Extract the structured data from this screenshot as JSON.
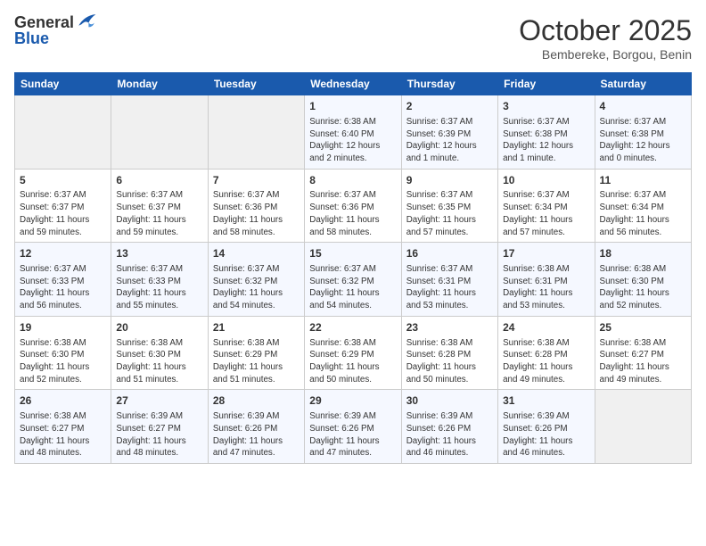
{
  "header": {
    "logo_general": "General",
    "logo_blue": "Blue",
    "month": "October 2025",
    "location": "Bembereke, Borgou, Benin"
  },
  "weekdays": [
    "Sunday",
    "Monday",
    "Tuesday",
    "Wednesday",
    "Thursday",
    "Friday",
    "Saturday"
  ],
  "weeks": [
    [
      {
        "day": "",
        "info": ""
      },
      {
        "day": "",
        "info": ""
      },
      {
        "day": "",
        "info": ""
      },
      {
        "day": "1",
        "info": "Sunrise: 6:38 AM\nSunset: 6:40 PM\nDaylight: 12 hours\nand 2 minutes."
      },
      {
        "day": "2",
        "info": "Sunrise: 6:37 AM\nSunset: 6:39 PM\nDaylight: 12 hours\nand 1 minute."
      },
      {
        "day": "3",
        "info": "Sunrise: 6:37 AM\nSunset: 6:38 PM\nDaylight: 12 hours\nand 1 minute."
      },
      {
        "day": "4",
        "info": "Sunrise: 6:37 AM\nSunset: 6:38 PM\nDaylight: 12 hours\nand 0 minutes."
      }
    ],
    [
      {
        "day": "5",
        "info": "Sunrise: 6:37 AM\nSunset: 6:37 PM\nDaylight: 11 hours\nand 59 minutes."
      },
      {
        "day": "6",
        "info": "Sunrise: 6:37 AM\nSunset: 6:37 PM\nDaylight: 11 hours\nand 59 minutes."
      },
      {
        "day": "7",
        "info": "Sunrise: 6:37 AM\nSunset: 6:36 PM\nDaylight: 11 hours\nand 58 minutes."
      },
      {
        "day": "8",
        "info": "Sunrise: 6:37 AM\nSunset: 6:36 PM\nDaylight: 11 hours\nand 58 minutes."
      },
      {
        "day": "9",
        "info": "Sunrise: 6:37 AM\nSunset: 6:35 PM\nDaylight: 11 hours\nand 57 minutes."
      },
      {
        "day": "10",
        "info": "Sunrise: 6:37 AM\nSunset: 6:34 PM\nDaylight: 11 hours\nand 57 minutes."
      },
      {
        "day": "11",
        "info": "Sunrise: 6:37 AM\nSunset: 6:34 PM\nDaylight: 11 hours\nand 56 minutes."
      }
    ],
    [
      {
        "day": "12",
        "info": "Sunrise: 6:37 AM\nSunset: 6:33 PM\nDaylight: 11 hours\nand 56 minutes."
      },
      {
        "day": "13",
        "info": "Sunrise: 6:37 AM\nSunset: 6:33 PM\nDaylight: 11 hours\nand 55 minutes."
      },
      {
        "day": "14",
        "info": "Sunrise: 6:37 AM\nSunset: 6:32 PM\nDaylight: 11 hours\nand 54 minutes."
      },
      {
        "day": "15",
        "info": "Sunrise: 6:37 AM\nSunset: 6:32 PM\nDaylight: 11 hours\nand 54 minutes."
      },
      {
        "day": "16",
        "info": "Sunrise: 6:37 AM\nSunset: 6:31 PM\nDaylight: 11 hours\nand 53 minutes."
      },
      {
        "day": "17",
        "info": "Sunrise: 6:38 AM\nSunset: 6:31 PM\nDaylight: 11 hours\nand 53 minutes."
      },
      {
        "day": "18",
        "info": "Sunrise: 6:38 AM\nSunset: 6:30 PM\nDaylight: 11 hours\nand 52 minutes."
      }
    ],
    [
      {
        "day": "19",
        "info": "Sunrise: 6:38 AM\nSunset: 6:30 PM\nDaylight: 11 hours\nand 52 minutes."
      },
      {
        "day": "20",
        "info": "Sunrise: 6:38 AM\nSunset: 6:30 PM\nDaylight: 11 hours\nand 51 minutes."
      },
      {
        "day": "21",
        "info": "Sunrise: 6:38 AM\nSunset: 6:29 PM\nDaylight: 11 hours\nand 51 minutes."
      },
      {
        "day": "22",
        "info": "Sunrise: 6:38 AM\nSunset: 6:29 PM\nDaylight: 11 hours\nand 50 minutes."
      },
      {
        "day": "23",
        "info": "Sunrise: 6:38 AM\nSunset: 6:28 PM\nDaylight: 11 hours\nand 50 minutes."
      },
      {
        "day": "24",
        "info": "Sunrise: 6:38 AM\nSunset: 6:28 PM\nDaylight: 11 hours\nand 49 minutes."
      },
      {
        "day": "25",
        "info": "Sunrise: 6:38 AM\nSunset: 6:27 PM\nDaylight: 11 hours\nand 49 minutes."
      }
    ],
    [
      {
        "day": "26",
        "info": "Sunrise: 6:38 AM\nSunset: 6:27 PM\nDaylight: 11 hours\nand 48 minutes."
      },
      {
        "day": "27",
        "info": "Sunrise: 6:39 AM\nSunset: 6:27 PM\nDaylight: 11 hours\nand 48 minutes."
      },
      {
        "day": "28",
        "info": "Sunrise: 6:39 AM\nSunset: 6:26 PM\nDaylight: 11 hours\nand 47 minutes."
      },
      {
        "day": "29",
        "info": "Sunrise: 6:39 AM\nSunset: 6:26 PM\nDaylight: 11 hours\nand 47 minutes."
      },
      {
        "day": "30",
        "info": "Sunrise: 6:39 AM\nSunset: 6:26 PM\nDaylight: 11 hours\nand 46 minutes."
      },
      {
        "day": "31",
        "info": "Sunrise: 6:39 AM\nSunset: 6:26 PM\nDaylight: 11 hours\nand 46 minutes."
      },
      {
        "day": "",
        "info": ""
      }
    ]
  ]
}
